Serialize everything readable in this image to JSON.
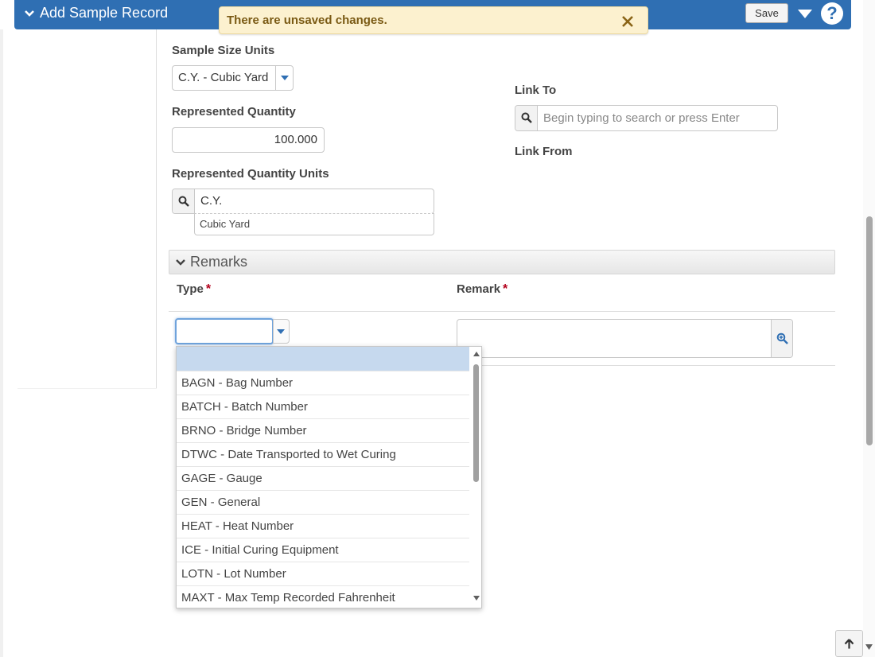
{
  "header": {
    "title": "Add Sample Record",
    "save_label": "Save",
    "help_label": "?"
  },
  "banner": {
    "message": "There are unsaved changes."
  },
  "form": {
    "sample_size_units": {
      "label": "Sample Size Units",
      "value": "C.Y. - Cubic Yard"
    },
    "represented_quantity": {
      "label": "Represented Quantity",
      "value": "100.000"
    },
    "represented_quantity_units": {
      "label": "Represented Quantity Units",
      "value": "C.Y.",
      "description": "Cubic Yard"
    },
    "link_to": {
      "label": "Link To",
      "placeholder": "Begin typing to search or press Enter"
    },
    "link_from": {
      "label": "Link From"
    }
  },
  "remarks": {
    "section_title": "Remarks",
    "type_header": "Type",
    "remark_header": "Remark",
    "required_marker": "*",
    "type_options": [
      "BAGN - Bag Number",
      "BATCH - Batch Number",
      "BRNO - Bridge Number",
      "DTWC - Date Transported to Wet Curing",
      "GAGE - Gauge",
      "GEN - General",
      "HEAT - Heat Number",
      "ICE - Initial Curing Equipment",
      "LOTN - Lot Number",
      "MAXT - Max Temp Recorded Fahrenheit"
    ]
  },
  "colors": {
    "header_bg": "#2f6fb3",
    "banner_bg": "#fcf1cf",
    "banner_text": "#7a5a14",
    "required": "#b3001b",
    "selected_option": "#c6d9ee"
  },
  "icons": {
    "header_chevron": "chevron-down-icon",
    "banner_close": "close-icon",
    "search": "search-icon",
    "zoom": "zoom-icon",
    "scroll_top": "arrow-up-icon"
  }
}
